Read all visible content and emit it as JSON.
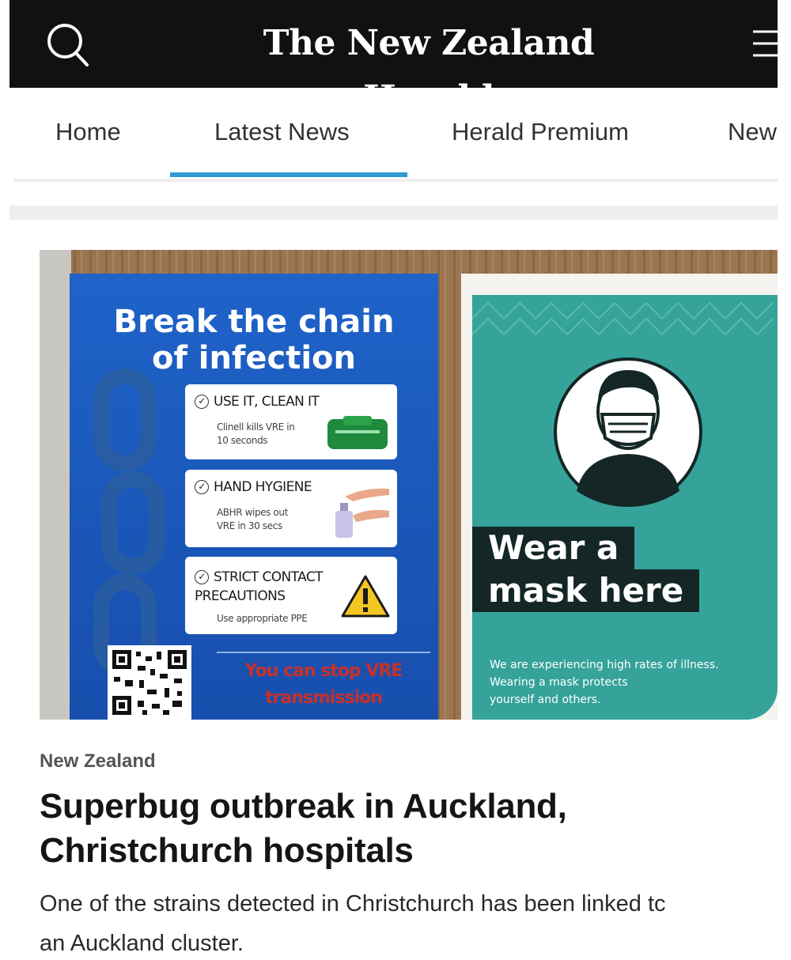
{
  "header": {
    "masthead": "The New Zealand Herald",
    "search_icon": "search-icon",
    "menu_icon": "hamburger-menu-icon"
  },
  "nav": {
    "tabs": [
      {
        "label": "Home",
        "active": false
      },
      {
        "label": "Latest News",
        "active": true
      },
      {
        "label": "Herald Premium",
        "active": false
      },
      {
        "label": "New",
        "active": false
      }
    ],
    "active_color": "#2d9bd6"
  },
  "article": {
    "image": {
      "left_poster": {
        "title_line1": "Break the chain",
        "title_line2": "of infection",
        "cards": [
          {
            "heading": "USE IT, CLEAN IT",
            "body_line1": "Clinell kills VRE in",
            "body_line2": "10 seconds"
          },
          {
            "heading": "HAND HYGIENE",
            "body_line1": "ABHR wipes out",
            "body_line2": "VRE in 30 secs"
          },
          {
            "heading": "STRICT CONTACT PRECAUTIONS",
            "body_line1": "Use appropriate PPE",
            "body_line2": ""
          }
        ],
        "stop_line1": "You can stop VRE",
        "stop_line2": "transmission",
        "background": "#1f63c9"
      },
      "right_poster": {
        "title_line1": "Wear a",
        "title_line2": "mask here",
        "body_line1": "We are experiencing high rates of illness.",
        "body_line2": "Wearing a mask protects",
        "body_line3": "yourself and others.",
        "background": "#35a39a"
      }
    },
    "section": "New Zealand",
    "headline": "Superbug outbreak in Auckland, Christchurch hospitals",
    "summary_line1": "One of the strains detected in Christchurch has been linked tc",
    "summary_line2": "an Auckland cluster."
  }
}
